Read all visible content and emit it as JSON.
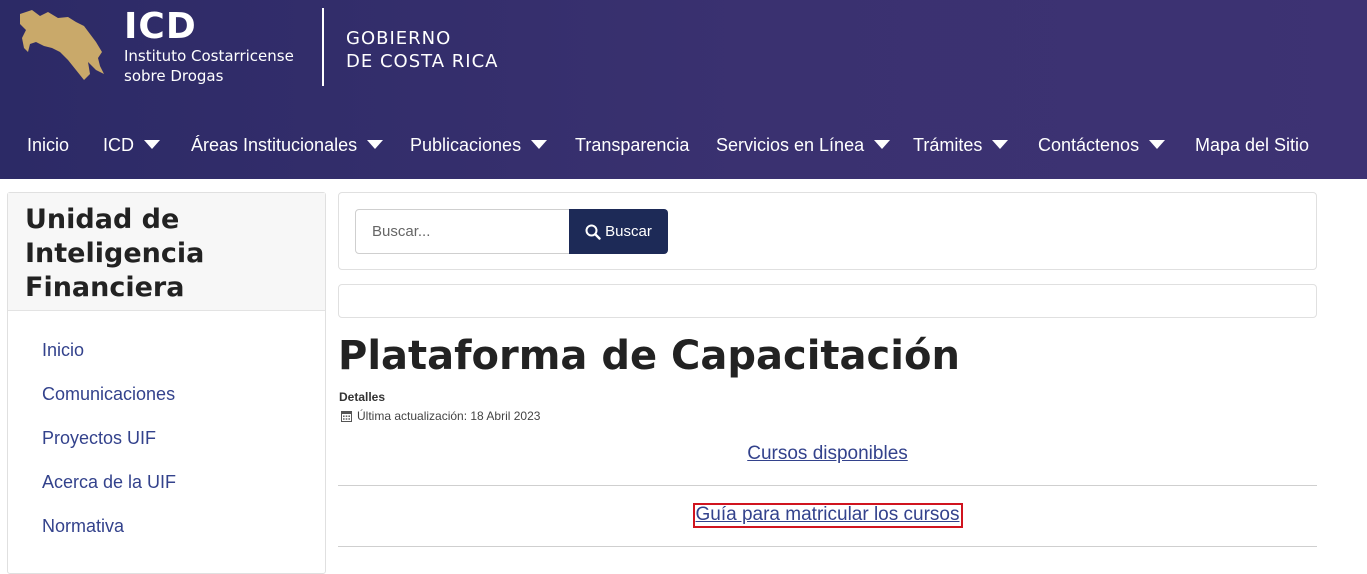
{
  "header": {
    "brand_title": "ICD",
    "brand_subtitle_line1": "Instituto Costarricense",
    "brand_subtitle_line2": "sobre Drogas",
    "gov_line1": "GOBIERNO",
    "gov_line2": "DE COSTA RICA",
    "logo_color": "#c9a96a",
    "background_color": "#2f2c68"
  },
  "nav": [
    {
      "label": "Inicio",
      "dropdown": false
    },
    {
      "label": "ICD",
      "dropdown": true
    },
    {
      "label": "Áreas Institucionales",
      "dropdown": true
    },
    {
      "label": "Publicaciones",
      "dropdown": true
    },
    {
      "label": "Transparencia",
      "dropdown": false
    },
    {
      "label": "Servicios en Línea",
      "dropdown": true
    },
    {
      "label": "Trámites",
      "dropdown": true
    },
    {
      "label": "Contáctenos",
      "dropdown": true
    },
    {
      "label": "Mapa del Sitio",
      "dropdown": false
    }
  ],
  "sidebar": {
    "title_line1": "Unidad de",
    "title_line2": "Inteligencia",
    "title_line3": "Financiera",
    "items": [
      {
        "label": "Inicio"
      },
      {
        "label": "Comunicaciones"
      },
      {
        "label": "Proyectos UIF"
      },
      {
        "label": "Acerca de la UIF"
      },
      {
        "label": "Normativa"
      }
    ]
  },
  "search": {
    "placeholder": "Buscar...",
    "button_label": "Buscar",
    "button_color": "#1d2a57"
  },
  "article": {
    "title": "Plataforma de Capacitación",
    "details_label": "Detalles",
    "updated_text": "Última actualización: 18 Abril 2023",
    "links": [
      {
        "label": "Cursos disponibles"
      },
      {
        "label": "Guía para matricular los cursos"
      }
    ],
    "link_color": "#33428c",
    "focus_color": "#d0141f"
  }
}
